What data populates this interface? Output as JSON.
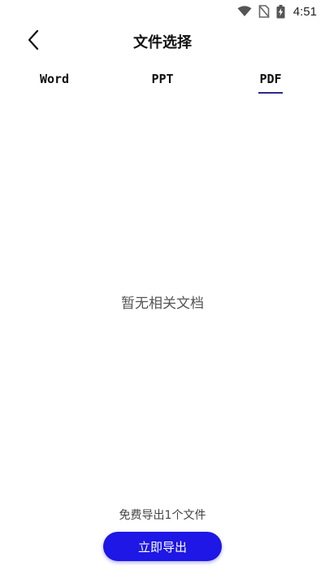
{
  "status_bar": {
    "time": "4:51",
    "icons": [
      "wifi-icon",
      "no-sim-icon",
      "battery-charging-icon"
    ]
  },
  "header": {
    "title": "文件选择",
    "back_icon": "chevron-left-icon"
  },
  "tabs": [
    {
      "label": "Word",
      "selected": false
    },
    {
      "label": "PPT",
      "selected": false
    },
    {
      "label": "PDF",
      "selected": true
    }
  ],
  "main": {
    "empty_message": "暂无相关文档"
  },
  "footer": {
    "hint": "免费导出1个文件",
    "export_button_label": "立即导出"
  },
  "colors": {
    "accent": "#1e17e6",
    "tab_indicator": "#2b2a8f",
    "background": "#ffffff"
  }
}
